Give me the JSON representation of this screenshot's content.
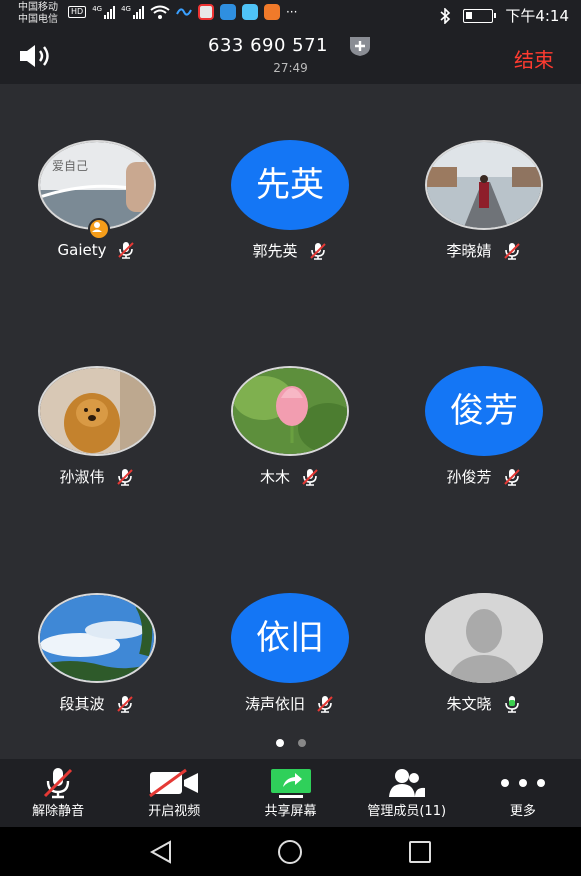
{
  "status_bar": {
    "carrier1": "中国移动",
    "carrier2": "中国电信",
    "hd": "HD",
    "net1": "4G",
    "net2": "4G",
    "more": "···",
    "time": "下午4:14"
  },
  "header": {
    "meeting_id": "633 690 571",
    "timer": "27:49",
    "end_label": "结束"
  },
  "participants": [
    {
      "name": "Gaiety",
      "avatar_type": "photo",
      "avatar_text": "",
      "mic": "muted",
      "host": true
    },
    {
      "name": "郭先英",
      "avatar_type": "text",
      "avatar_text": "先英",
      "mic": "muted"
    },
    {
      "name": "李晓婧",
      "avatar_type": "photo",
      "avatar_text": "",
      "mic": "muted"
    },
    {
      "name": "孙淑伟",
      "avatar_type": "photo",
      "avatar_text": "",
      "mic": "muted"
    },
    {
      "name": "木木",
      "avatar_type": "photo",
      "avatar_text": "",
      "mic": "muted"
    },
    {
      "name": "孙俊芳",
      "avatar_type": "text",
      "avatar_text": "俊芳",
      "mic": "muted"
    },
    {
      "name": "段其波",
      "avatar_type": "photo",
      "avatar_text": "",
      "mic": "muted"
    },
    {
      "name": "涛声依旧",
      "avatar_type": "text",
      "avatar_text": "依旧",
      "mic": "muted"
    },
    {
      "name": "朱文晓",
      "avatar_type": "default",
      "avatar_text": "",
      "mic": "active"
    }
  ],
  "pagination": {
    "pages": 2,
    "current": 1
  },
  "toolbar": {
    "unmute": "解除静音",
    "video": "开启视频",
    "share": "共享屏幕",
    "members": "管理成员(11)",
    "more": "更多"
  },
  "colors": {
    "accent_blue": "#1476f5",
    "end_red": "#ff3b30",
    "mic_active": "#3ccf4e",
    "share_green": "#2fd05a",
    "muted_red": "#e53935"
  }
}
